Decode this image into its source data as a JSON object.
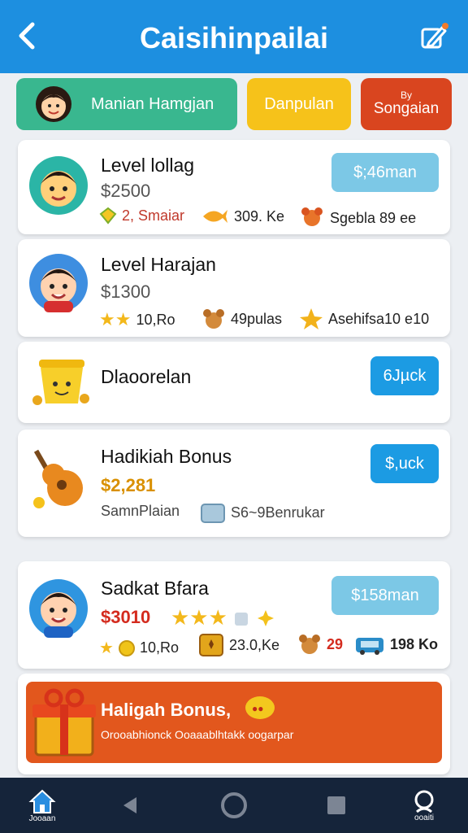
{
  "header": {
    "title": "Caisihinpailai"
  },
  "tabs": [
    {
      "label": "Manian Hamgjan"
    },
    {
      "label": "Danpulan"
    },
    {
      "label": "Songaian",
      "sup": "By"
    }
  ],
  "cards": [
    {
      "name": "Level lollag",
      "price": "$2500",
      "button": "$;46man",
      "stats": [
        "2, Smaiar",
        "309. Ke",
        "Sgebla 89 ee"
      ]
    },
    {
      "name": "Level Harajan",
      "price": "$1300",
      "stats": [
        "10,Ro",
        "49pulas",
        "Asehifsa10 e10"
      ]
    },
    {
      "name": "Dlaoorelan",
      "button": "6Jµck"
    },
    {
      "name": "Hadikiah Bonus",
      "price": "$2,281",
      "button": "$,uck",
      "stats": [
        "SamnPlaian",
        "S6~9Benrukar"
      ]
    },
    {
      "name": "Sadkat Bfara",
      "price": "$3010",
      "button": "$158man",
      "stats": [
        "10,Ro",
        "23.0,Ke",
        "29",
        "198 Ko"
      ]
    }
  ],
  "bonus": {
    "title": "Haligah Bonus,",
    "desc": "Orooabhionck Ooaaablhtakk oogarpar"
  },
  "nav": {
    "home_label": "Jooaan",
    "search_label": "ooaiti"
  },
  "colors": {
    "header": "#1d8fe0",
    "green": "#39b78f",
    "yellow": "#f6c21a",
    "red": "#d9451f",
    "accent": "#1c9be3"
  }
}
